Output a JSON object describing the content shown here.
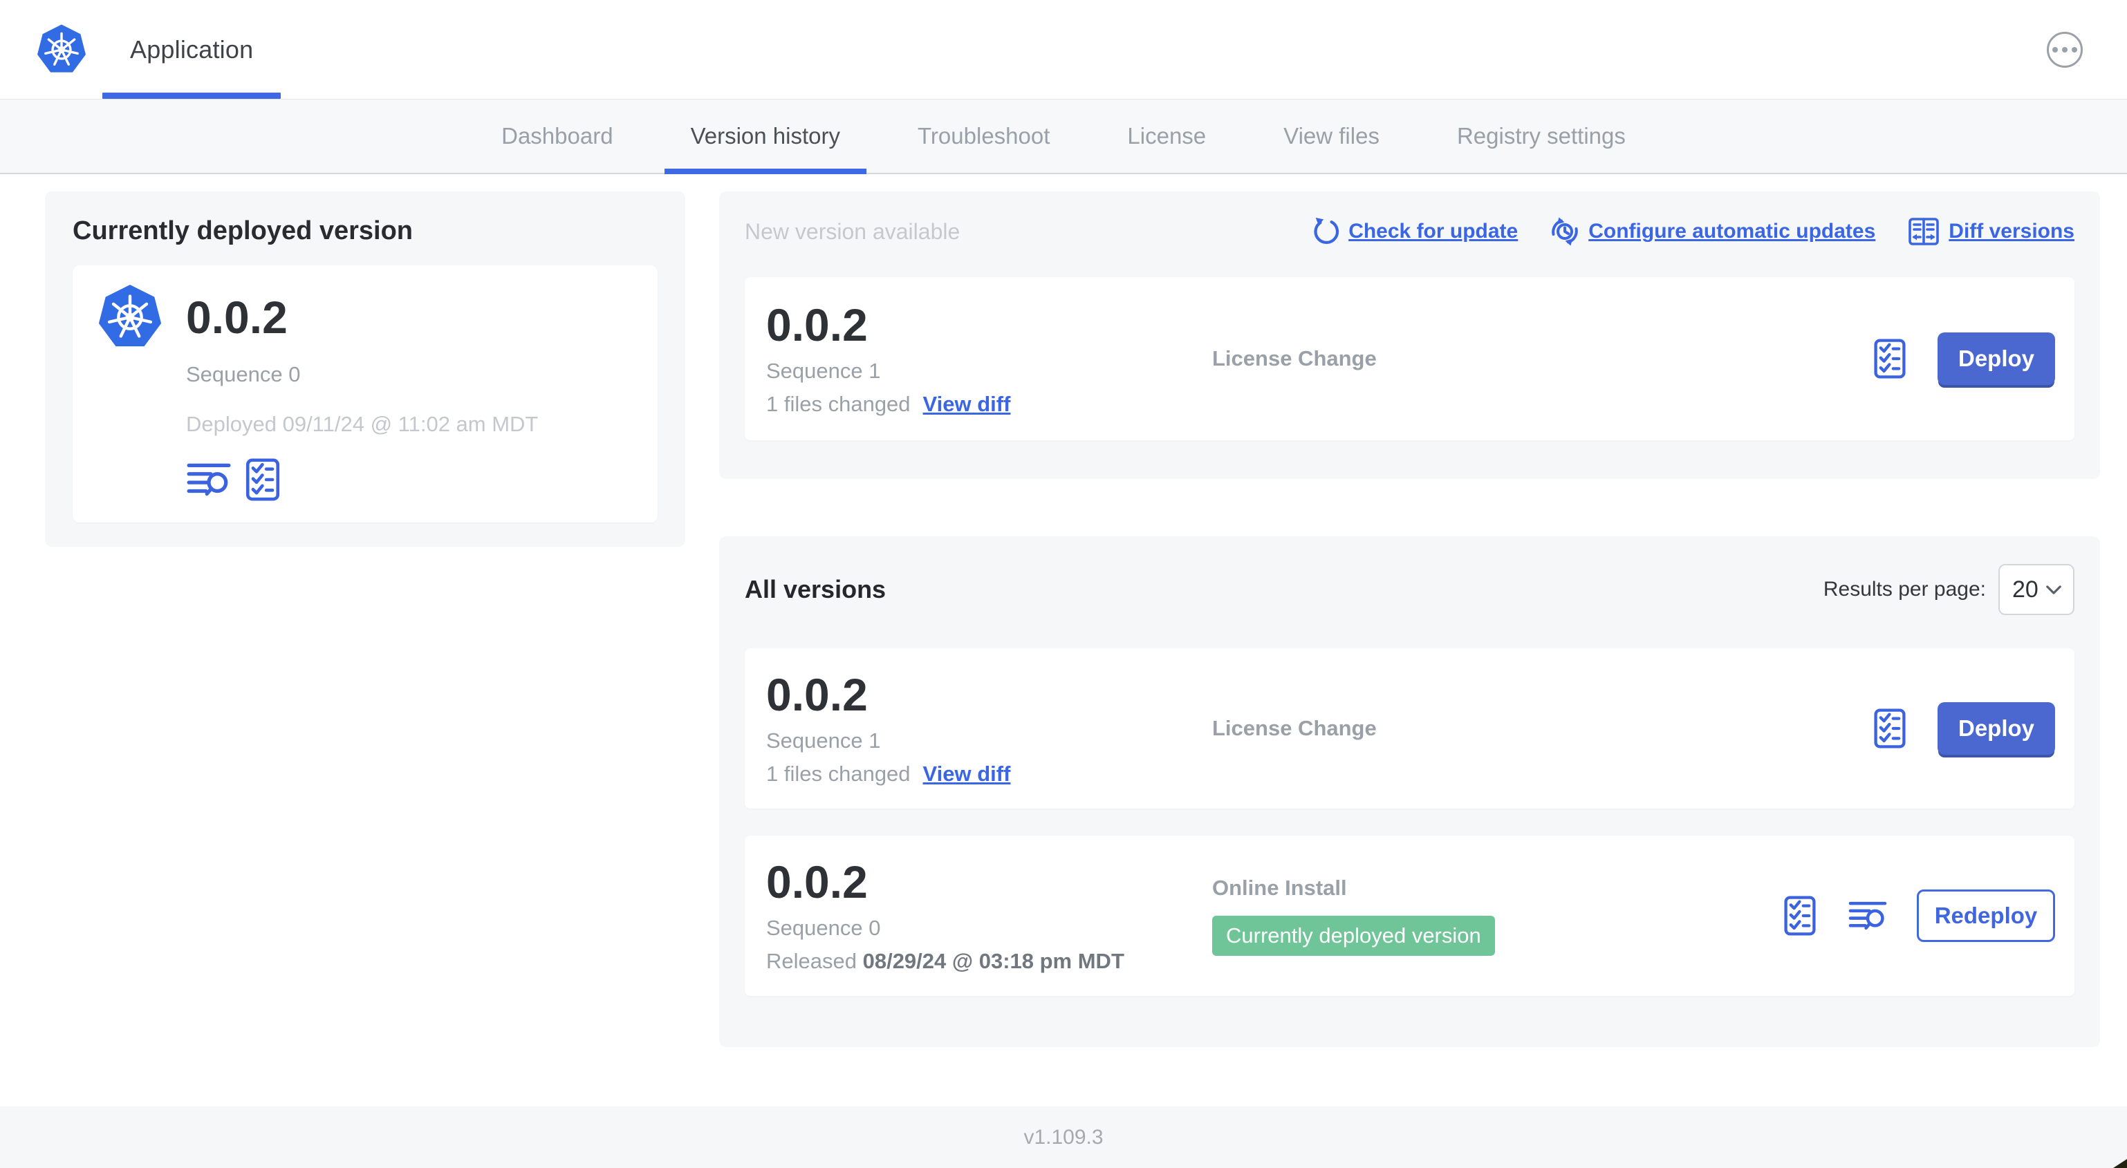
{
  "header": {
    "app_tab_label": "Application"
  },
  "nav": {
    "tabs": [
      {
        "label": "Dashboard",
        "active": false
      },
      {
        "label": "Version history",
        "active": true
      },
      {
        "label": "Troubleshoot",
        "active": false
      },
      {
        "label": "License",
        "active": false
      },
      {
        "label": "View files",
        "active": false
      },
      {
        "label": "Registry settings",
        "active": false
      }
    ]
  },
  "deployed_panel": {
    "title": "Currently deployed version",
    "version": "0.0.2",
    "sequence": "Sequence 0",
    "deployed": "Deployed 09/11/24 @ 11:02 am MDT"
  },
  "new_version": {
    "title": "New version available",
    "links": {
      "check": "Check for update",
      "configure": "Configure automatic updates",
      "diff": "Diff versions"
    },
    "card": {
      "version": "0.0.2",
      "sequence": "Sequence 1",
      "files_changed": "1 files changed",
      "view_diff": "View diff",
      "status": "License Change",
      "action": "Deploy"
    }
  },
  "all_versions": {
    "title": "All versions",
    "results_label": "Results per page:",
    "results_value": "20",
    "rows": [
      {
        "version": "0.0.2",
        "sequence": "Sequence 1",
        "files_changed": "1 files changed",
        "view_diff": "View diff",
        "status": "License Change",
        "action": "Deploy"
      },
      {
        "version": "0.0.2",
        "sequence": "Sequence 0",
        "released_label": "Released ",
        "released_date": "08/29/24 @ 03:18 pm MDT",
        "status": "Online Install",
        "badge": "Currently deployed version",
        "action": "Redeploy"
      }
    ]
  },
  "footer": {
    "version": "v1.109.3"
  },
  "colors": {
    "accent_blue": "#3a66e4",
    "button_blue": "#4a68d0",
    "badge_green": "#6fc598",
    "kubernetes_blue": "#326ce5"
  }
}
